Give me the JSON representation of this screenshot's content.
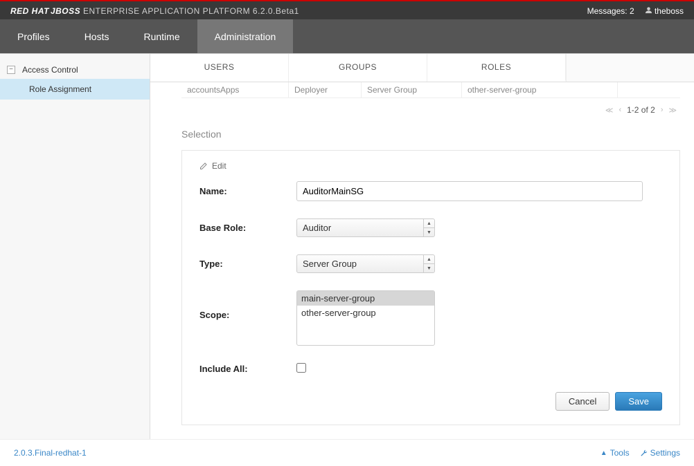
{
  "header": {
    "brand_red": "RED HAT",
    "brand_jboss": "JBOSS",
    "brand_eap": " ENTERPRISE APPLICATION PLATFORM ",
    "version": "6.2.0.Beta1",
    "messages_label": "Messages: 2",
    "username": "theboss"
  },
  "nav": {
    "tabs": [
      "Profiles",
      "Hosts",
      "Runtime",
      "Administration"
    ],
    "active": "Administration"
  },
  "sidebar": {
    "root": "Access Control",
    "child": "Role Assignment"
  },
  "subtabs": {
    "items": [
      "USERS",
      "GROUPS",
      "ROLES"
    ],
    "active": "ROLES"
  },
  "table": {
    "row": {
      "c1": "accountsApps",
      "c2": "Deployer",
      "c3": "Server Group",
      "c4": "other-server-group"
    }
  },
  "pager": {
    "text": "1-2 of 2"
  },
  "section": {
    "title": "Selection"
  },
  "form": {
    "edit_label": "Edit",
    "name_label": "Name:",
    "name_value": "AuditorMainSG",
    "base_role_label": "Base Role:",
    "base_role_value": "Auditor",
    "type_label": "Type:",
    "type_value": "Server Group",
    "scope_label": "Scope:",
    "scope_options": [
      "main-server-group",
      "other-server-group"
    ],
    "scope_selected": "main-server-group",
    "include_all_label": "Include All:",
    "cancel": "Cancel",
    "save": "Save"
  },
  "footer": {
    "version": "2.0.3.Final-redhat-1",
    "tools": "Tools",
    "settings": "Settings"
  }
}
